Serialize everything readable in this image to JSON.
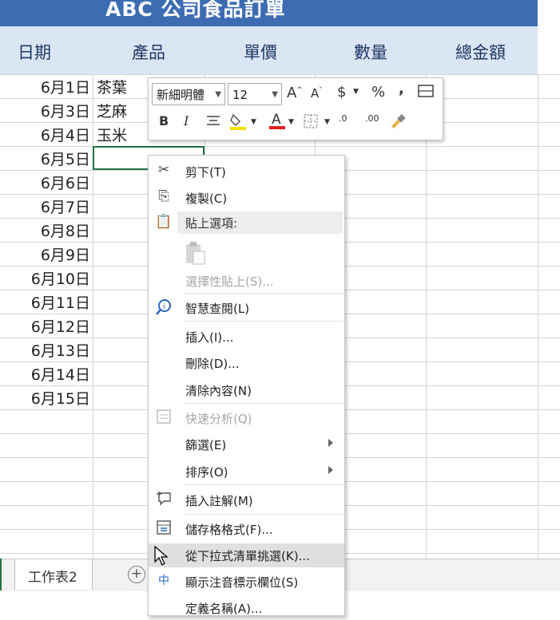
{
  "title": "ABC 公司食品訂單",
  "headers": [
    "日期",
    "產品",
    "單價",
    "數量",
    "總金額"
  ],
  "rows": [
    {
      "date": "6月1日",
      "product": "茶葉"
    },
    {
      "date": "6月3日",
      "product": "芝麻"
    },
    {
      "date": "6月4日",
      "product": "玉米"
    },
    {
      "date": "6月5日",
      "product": ""
    },
    {
      "date": "6月6日",
      "product": ""
    },
    {
      "date": "6月7日",
      "product": ""
    },
    {
      "date": "6月8日",
      "product": ""
    },
    {
      "date": "6月9日",
      "product": ""
    },
    {
      "date": "6月10日",
      "product": ""
    },
    {
      "date": "6月11日",
      "product": ""
    },
    {
      "date": "6月12日",
      "product": ""
    },
    {
      "date": "6月13日",
      "product": ""
    },
    {
      "date": "6月14日",
      "product": ""
    },
    {
      "date": "6月15日",
      "product": ""
    }
  ],
  "mini_toolbar": {
    "font_name": "新細明體",
    "font_size": "12",
    "icons": [
      "increase-font-icon",
      "decrease-font-icon",
      "currency-icon",
      "percent-icon",
      "comma-icon",
      "merge-icon",
      "bold-icon",
      "italic-icon",
      "align-center-icon",
      "fill-color-icon",
      "font-color-icon",
      "borders-icon",
      "increase-decimal-icon",
      "decrease-decimal-icon",
      "format-painter-icon"
    ],
    "bold": "B",
    "italic": "I",
    "percent": "%",
    "comma": ",",
    "currency": "$",
    "increase_decimal": ".00",
    "decrease_decimal": ".0"
  },
  "context_menu": {
    "cut": "剪下(T)",
    "copy": "複製(C)",
    "paste_options": "貼上選項:",
    "paste_special": "選擇性貼上(S)...",
    "smart_lookup": "智慧查閱(L)",
    "insert": "插入(I)...",
    "delete": "刪除(D)...",
    "clear": "清除內容(N)",
    "quick_analysis": "快速分析(Q)",
    "filter": "篩選(E)",
    "sort": "排序(O)",
    "insert_comment": "插入註解(M)",
    "format_cells": "儲存格格式(F)...",
    "pick_from_list": "從下拉式清單挑選(K)...",
    "phonetic": "顯示注音標示欄位(S)",
    "define_name": "定義名稱(A)..."
  },
  "sheet_tab": "工作表2",
  "add_sheet": "+",
  "phonetic_icon_text": "中",
  "accent_color": "#217346",
  "title_color": "#3d6cb3"
}
